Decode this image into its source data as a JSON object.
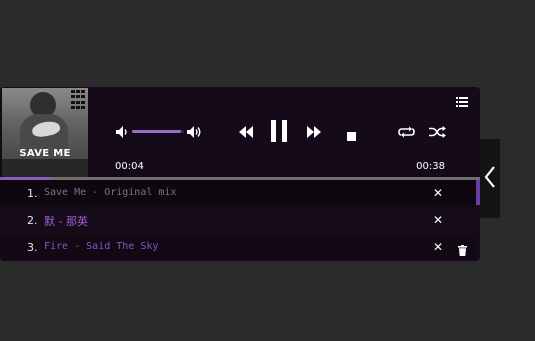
{
  "album": {
    "title": "SAVE ME"
  },
  "player": {
    "time_current": "00:04",
    "time_total": "00:38",
    "progress_fraction": 0.105,
    "volume_fraction": 0.95
  },
  "icons": {
    "playlist": "playlist-icon",
    "volume_low": "volume-low-icon",
    "volume_high": "volume-high-icon",
    "prev": "rewind-icon",
    "pause": "pause-icon",
    "next": "fast-forward-icon",
    "stop": "stop-icon",
    "loop": "repeat-icon",
    "shuffle": "shuffle-icon",
    "remove": "close-icon",
    "trash": "trash-icon",
    "collapse": "chevron-left-icon"
  },
  "playlist": {
    "items": [
      {
        "number": "1.",
        "title": "Save Me - Original mix",
        "remove": "✕"
      },
      {
        "number": "2.",
        "title": "默 - 那英",
        "remove": "✕"
      },
      {
        "number": "3.",
        "title": "Fire - Said The Sky",
        "remove": "✕"
      }
    ]
  },
  "colors": {
    "accent": "#8c5cc0",
    "player_bg": "#150a1a",
    "page_bg": "#2b2b2b"
  }
}
